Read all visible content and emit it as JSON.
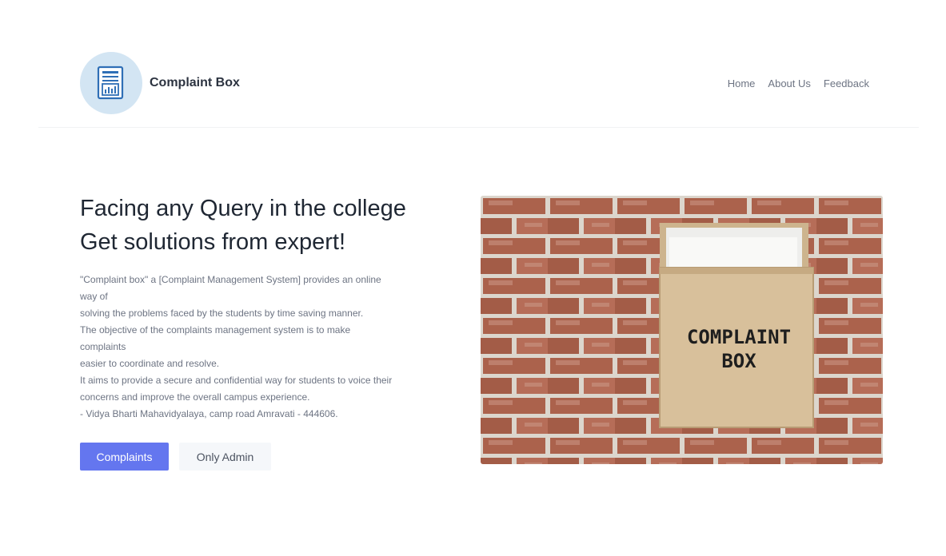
{
  "brand": {
    "name": "Complaint Box",
    "logo_icon": "document-chart-icon"
  },
  "nav": {
    "items": [
      "Home",
      "About Us",
      "Feedback"
    ]
  },
  "hero": {
    "title_lines": [
      "Facing any Query in the college",
      "Get solutions from expert!"
    ],
    "description_lines": [
      "\"Complaint box\" a [Complaint Management System] provides an online",
      "way of",
      "solving the problems faced by the students by time saving manner.",
      "The objective of the complaints management system is to make",
      "complaints",
      "easier to coordinate and resolve.",
      "It aims to provide a secure and confidential way for students to voice their",
      "concerns and improve the overall campus experience.",
      "- Vidya Bharti Mahavidyalaya, camp road Amravati - 444606."
    ],
    "primary_button": "Complaints",
    "secondary_button": "Only Admin"
  },
  "image": {
    "box_label_lines": [
      "COMPLAINT",
      "BOX"
    ]
  },
  "colors": {
    "accent": "#6476ef",
    "logo_bg": "#d3e5f3",
    "logo_icon": "#2f6fb6"
  }
}
